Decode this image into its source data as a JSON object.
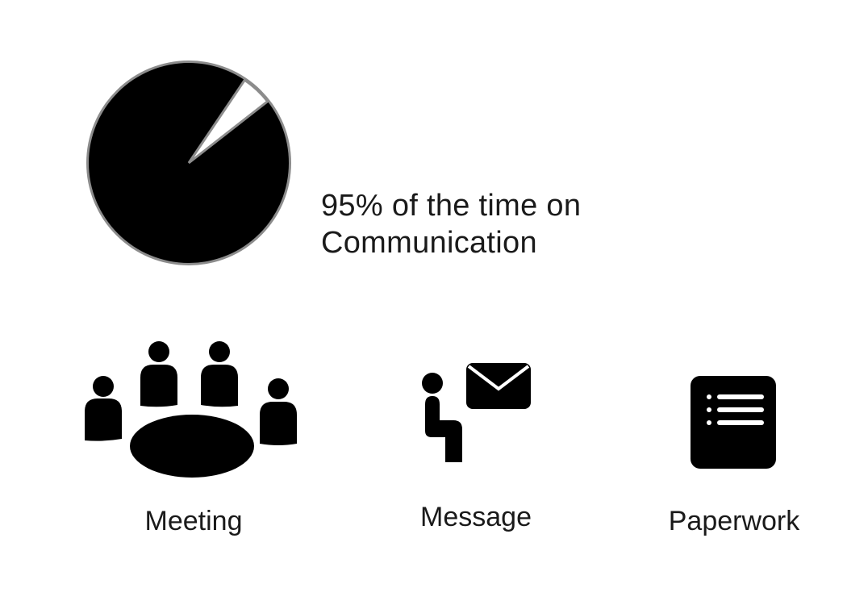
{
  "headline": {
    "line1": "95% of the time on",
    "line2": "Communication"
  },
  "pie": {
    "main_percent": 95,
    "fill_color": "#000000",
    "outline_color": "#8c8c8c",
    "wedge_color": "#ffffff"
  },
  "activities": [
    {
      "label": "Meeting",
      "icon": "meeting-icon"
    },
    {
      "label": "Message",
      "icon": "message-icon"
    },
    {
      "label": "Paperwork",
      "icon": "paperwork-icon"
    }
  ]
}
